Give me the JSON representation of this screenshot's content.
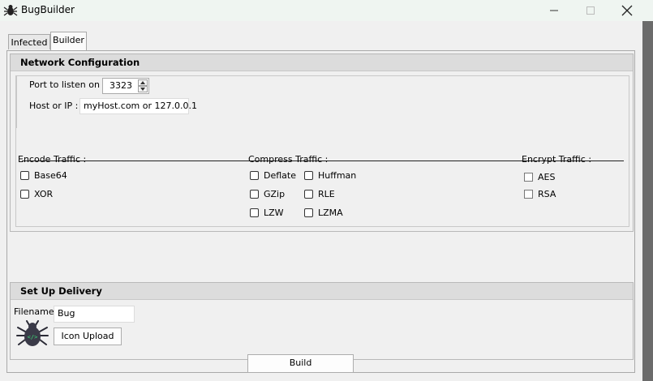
{
  "window": {
    "title": "BugBuilder",
    "icon": "spider-icon",
    "controls": [
      "minimize-icon",
      "maximize-icon",
      "close-icon"
    ]
  },
  "tabs": [
    {
      "label": "Infected",
      "selected": false
    },
    {
      "label": "Builder",
      "selected": true
    }
  ],
  "network": {
    "header": "Network Configuration",
    "port_label": "Port to listen on :",
    "port_value": "3323",
    "host_label": "Host or IP :",
    "host_value": "myHost.com or 127.0.0.1"
  },
  "encode": {
    "label": "Encode Traffic :",
    "options": [
      {
        "label": "Base64",
        "checked": false
      },
      {
        "label": "XOR",
        "checked": false
      }
    ]
  },
  "compress": {
    "label": "Compress Traffic :",
    "options": [
      {
        "label": "Deflate",
        "checked": false
      },
      {
        "label": "Huffman",
        "checked": false
      },
      {
        "label": "GZip",
        "checked": false
      },
      {
        "label": "RLE",
        "checked": false
      },
      {
        "label": "LZW",
        "checked": false
      },
      {
        "label": "LZMA",
        "checked": false
      }
    ]
  },
  "encrypt": {
    "label": "Encrypt Traffic :",
    "options": [
      {
        "label": "AES",
        "checked": false
      },
      {
        "label": "RSA",
        "checked": false
      }
    ]
  },
  "delivery": {
    "header": "Set Up Delivery",
    "filename_label": "Filename",
    "filename_value": "Bug",
    "icon_upload_label": "Icon Upload",
    "icon_preview": "bug-code-icon"
  },
  "build_label": "Build"
}
